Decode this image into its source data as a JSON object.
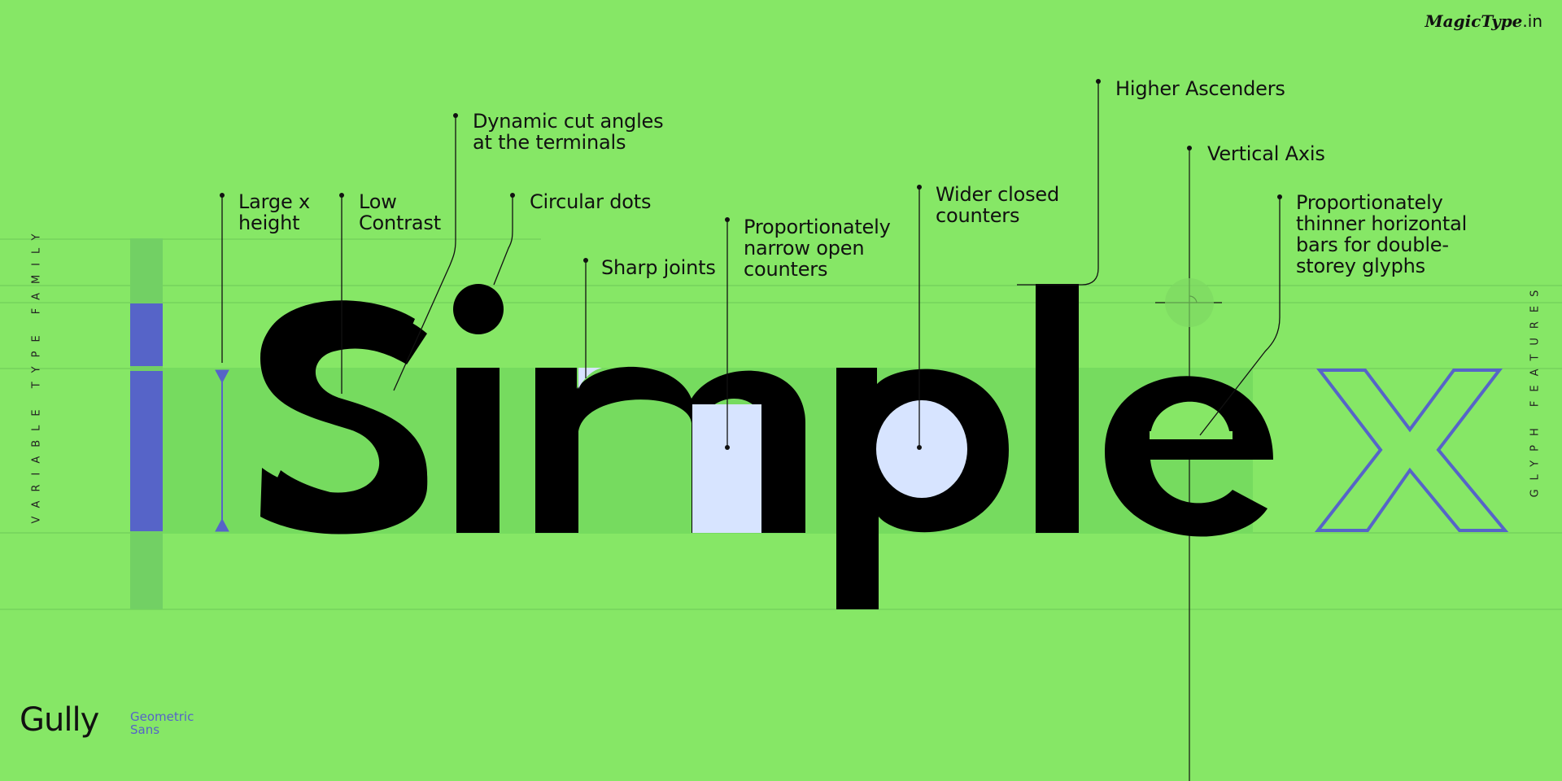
{
  "brand": {
    "name": "MagicType",
    "suffix": ".in"
  },
  "specimen": {
    "word": [
      "S",
      "i",
      "m",
      "p",
      "l",
      "e"
    ],
    "outline_glyph": "x",
    "colors": {
      "background": "#86e766",
      "glyph": "#000000",
      "accent": "#5664c8",
      "counter_fill": "#d7e4ff",
      "band": "#72d65e"
    }
  },
  "side_labels": {
    "left": "VARIABLE TYPE FAMILY",
    "right": "GLYPH FEATURES"
  },
  "annotations": [
    "Large x\nheight",
    "Low\nContrast",
    "Dynamic cut angles\nat the terminals",
    "Circular dots",
    "Sharp joints",
    "Proportionately\nnarrow open\ncounters",
    "Wider closed\ncounters",
    "Higher Ascenders",
    "Vertical Axis",
    "Proportionately\nthinner horizontal\nbars for double-\nstorey glyphs"
  ],
  "family": {
    "name": "Gully",
    "classification": "Geometric\nSans"
  }
}
